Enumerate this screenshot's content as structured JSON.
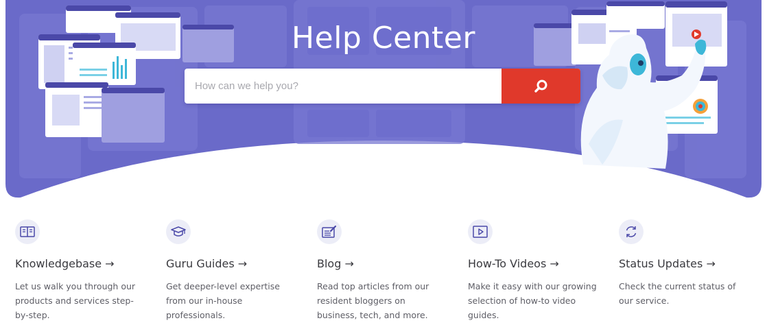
{
  "hero": {
    "title": "Help Center",
    "background_color": "#6a6ac9",
    "search": {
      "placeholder": "How can we help you?",
      "value": "",
      "button_color": "#e0392b",
      "button_icon": "search-icon"
    }
  },
  "features": [
    {
      "title": "Knowledgebase →",
      "icon": "book-icon",
      "description": "Let us walk you through our products and services step-by-step."
    },
    {
      "title": "Guru Guides →",
      "icon": "graduation-cap-icon",
      "description": "Get deeper-level expertise from our in-house professionals."
    },
    {
      "title": "Blog →",
      "icon": "edit-document-icon",
      "description": "Read top articles from our resident bloggers on business, tech, and more."
    },
    {
      "title": "How-To Videos →",
      "icon": "play-video-icon",
      "description": "Make it easy with our growing selection of how-to video guides."
    },
    {
      "title": "Status Updates →",
      "icon": "refresh-icon",
      "description": "Check the current status of our service."
    }
  ]
}
